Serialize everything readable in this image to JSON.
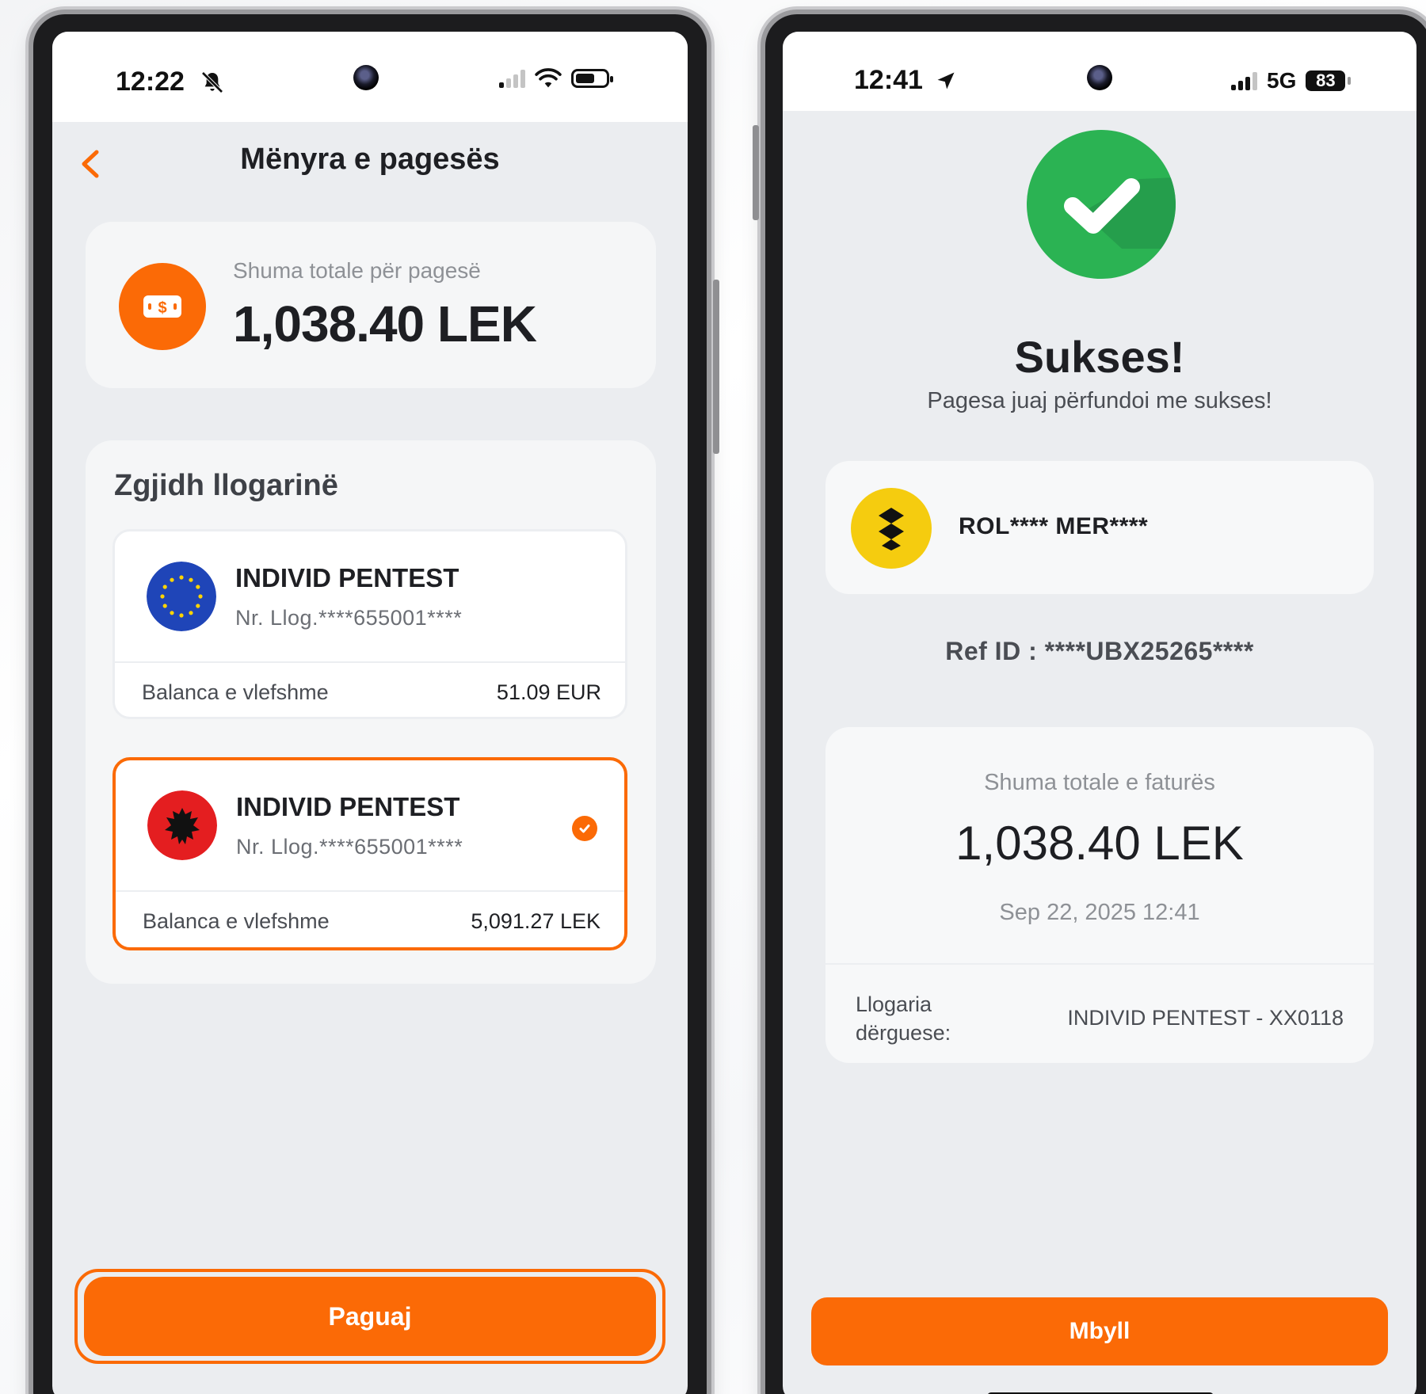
{
  "left_phone": {
    "status": {
      "time": "12:22",
      "silent_icon": "bell-slash-icon",
      "signal": "cellular-signal-icon",
      "wifi": "wifi-icon",
      "battery": "battery-icon"
    },
    "header": {
      "title": "Mënyra e pagesës",
      "back_icon": "chevron-left-icon"
    },
    "total": {
      "label": "Shuma totale për pagesë",
      "amount": "1,038.40 LEK",
      "icon": "money-icon"
    },
    "accounts_section": {
      "title": "Zgjidh llogarinë",
      "accounts": [
        {
          "name": "INDIVID PENTEST",
          "number": "Nr. Llog.****655001****",
          "balance_label": "Balanca e vlefshme",
          "balance": "51.09 EUR",
          "flag": "eu-flag-icon",
          "selected": false
        },
        {
          "name": "INDIVID PENTEST",
          "number": "Nr. Llog.****655001****",
          "balance_label": "Balanca e vlefshme",
          "balance": "5,091.27 LEK",
          "flag": "albania-flag-icon",
          "selected": true
        }
      ]
    },
    "pay_button": "Paguaj"
  },
  "right_phone": {
    "status": {
      "time": "12:41",
      "location_icon": "location-arrow-icon",
      "network": "5G",
      "battery": "83"
    },
    "success": {
      "title": "Sukses!",
      "subtitle": "Pagesa juaj përfundoi me sukses!",
      "icon": "checkmark-icon"
    },
    "merchant": {
      "name": "ROL**** MER****",
      "logo": "merchant-logo-icon"
    },
    "ref_id": "Ref ID : ****UBX25265****",
    "invoice": {
      "label": "Shuma totale e faturës",
      "amount": "1,038.40 LEK",
      "date": "Sep 22, 2025 12:41",
      "from_label": "Llogaria dërguese:",
      "from_value": "INDIVID PENTEST  -  XX0118"
    },
    "close_button": "Mbyll"
  },
  "colors": {
    "accent": "#fb6a06",
    "success": "#2bb353",
    "background": "#ebedf0",
    "card": "#f5f6f7",
    "text": "#1e1f23",
    "muted": "#8e9196"
  }
}
